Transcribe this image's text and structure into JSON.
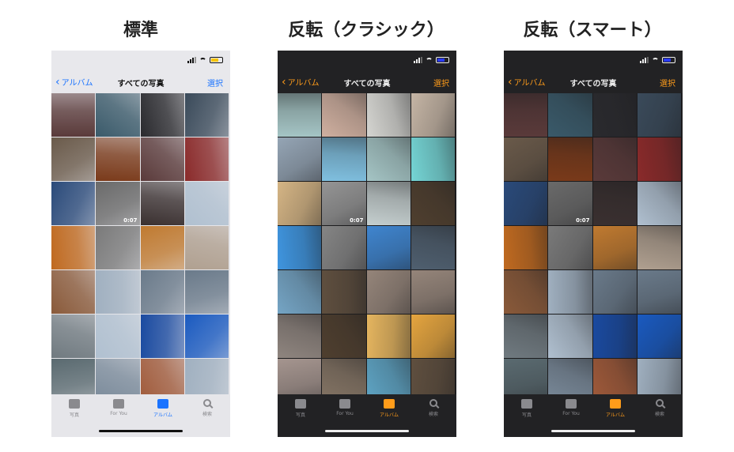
{
  "panels": [
    {
      "title": "標準",
      "theme": "light",
      "accent": "#1a73ff",
      "nav": {
        "back": "アルバム",
        "title": "すべての写真",
        "select": "選択"
      },
      "duration": "0:07",
      "tabs": [
        "写真",
        "For You",
        "アルバム",
        "検索"
      ],
      "active_tab": 2
    },
    {
      "title": "反転（クラシック）",
      "theme": "dark",
      "accent": "#ff9c1a",
      "nav": {
        "back": "アルバム",
        "title": "すべての写真",
        "select": "選択"
      },
      "duration": "0:07",
      "tabs": [
        "写真",
        "For You",
        "アルバム",
        "検索"
      ],
      "active_tab": 2
    },
    {
      "title": "反転（スマート）",
      "theme": "dark",
      "accent": "#ff9c1a",
      "nav": {
        "back": "アルバム",
        "title": "すべての写真",
        "select": "選択"
      },
      "duration": "0:07",
      "tabs": [
        "写真",
        "For You",
        "アルバム",
        "検索"
      ],
      "active_tab": 2
    }
  ],
  "photos_normal": [
    "#5a3a3a",
    "#3a5a6a",
    "#2a2a2e",
    "#3a4a5a",
    "#6a5a4a",
    "#7a3a1a",
    "#5a3a3a",
    "#8a2a2a",
    "#2a4a7a",
    "#6a6a6a",
    "#3a3030",
    "#b0c0d0",
    "#c06a20",
    "#7a7a7a",
    "#c07a30",
    "#b0a090",
    "#8a5a3a",
    "#a0b0c0",
    "#6a7a8a",
    "#6a7a8a",
    "#707a80",
    "#b0c0d0",
    "#1a4aa0",
    "#1a5ac0",
    "#5a6a70",
    "#7a8a9a",
    "#a05a3a",
    "#a0b0c0"
  ],
  "photos_classic": [
    "#a5c5c5",
    "#d0b0a0",
    "#d5d5d1",
    "#c5b5a5",
    "#95a5b5",
    "#80c0e0",
    "#a5c5c5",
    "#75d5d5",
    "#d5b585",
    "#959595",
    "#c5cfcf",
    "#4f3f2f",
    "#3f95df",
    "#858585",
    "#3f85cf",
    "#4f5f6f",
    "#75a5c5",
    "#5f4f3f",
    "#95857a",
    "#95857a",
    "#8f857f",
    "#4f3f2f",
    "#e5b55f",
    "#e5a53f",
    "#a5958f",
    "#857565",
    "#5fa5c5",
    "#5f4f3f"
  ],
  "grid_size": 28,
  "video_cell": 9
}
